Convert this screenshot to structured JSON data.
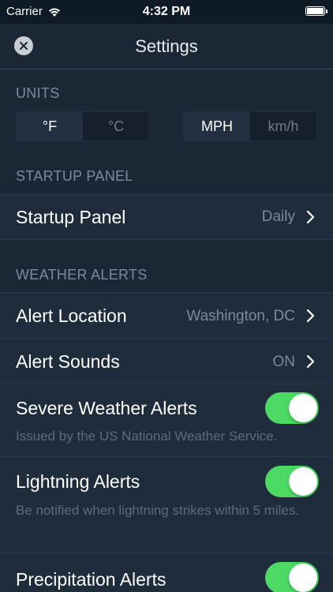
{
  "status_bar": {
    "carrier": "Carrier",
    "time": "4:32 PM",
    "icons": [
      "wifi-icon",
      "battery-icon"
    ]
  },
  "nav": {
    "title": "Settings",
    "close_icon": "close-icon"
  },
  "units": {
    "header": "UNITS",
    "temperature": {
      "options": [
        "°F",
        "°C"
      ],
      "selected": "°F"
    },
    "speed": {
      "options": [
        "MPH",
        "km/h"
      ],
      "selected": "MPH"
    }
  },
  "startup": {
    "header": "STARTUP PANEL",
    "label": "Startup Panel",
    "value": "Daily"
  },
  "alerts": {
    "header": "WEATHER ALERTS",
    "location": {
      "label": "Alert Location",
      "value": "Washington, DC"
    },
    "sounds": {
      "label": "Alert Sounds",
      "value": "ON"
    },
    "severe": {
      "label": "Severe Weather Alerts",
      "sub": "Issued by the US National Weather Service.",
      "on": true
    },
    "lightning": {
      "label": "Lightning Alerts",
      "sub": "Be notified when lightning strikes within 5 miles.",
      "on": true
    },
    "precipitation": {
      "label": "Precipitation Alerts",
      "on": true
    }
  },
  "colors": {
    "background": "#1b2735",
    "toggle_on": "#4cd964",
    "muted_text": "#7c8a99"
  }
}
